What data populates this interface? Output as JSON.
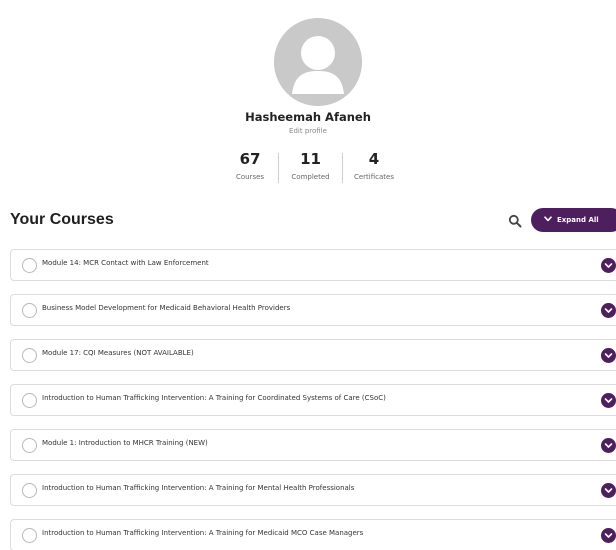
{
  "profile": {
    "name": "Hasheemah Afaneh",
    "edit_label": "Edit profile",
    "stats": [
      {
        "value": "67",
        "label": "Courses"
      },
      {
        "value": "11",
        "label": "Completed"
      },
      {
        "value": "4",
        "label": "Certificates"
      }
    ]
  },
  "courses": {
    "title": "Your Courses",
    "expand_all_label": "Expand All",
    "items": [
      "Module 14: MCR Contact with Law Enforcement",
      "Business Model Development for Medicaid Behavioral Health Providers",
      "Module 17: CQI Measures (NOT AVAILABLE)",
      "Introduction to Human Trafficking Intervention: A Training for Coordinated Systems of Care (CSoC)",
      "Module 1: Introduction to MHCR Training (NEW)",
      "Introduction to Human Trafficking Intervention: A Training for Mental Health Professionals",
      "Introduction to Human Trafficking Intervention: A Training for Medicaid MCO Case Managers"
    ]
  },
  "colors": {
    "accent": "#4d1f5e",
    "avatar_bg": "#c9c9c9",
    "border": "#dcdcdc"
  },
  "icons": [
    "avatar-placeholder-icon",
    "search-icon",
    "chevron-down-icon"
  ]
}
